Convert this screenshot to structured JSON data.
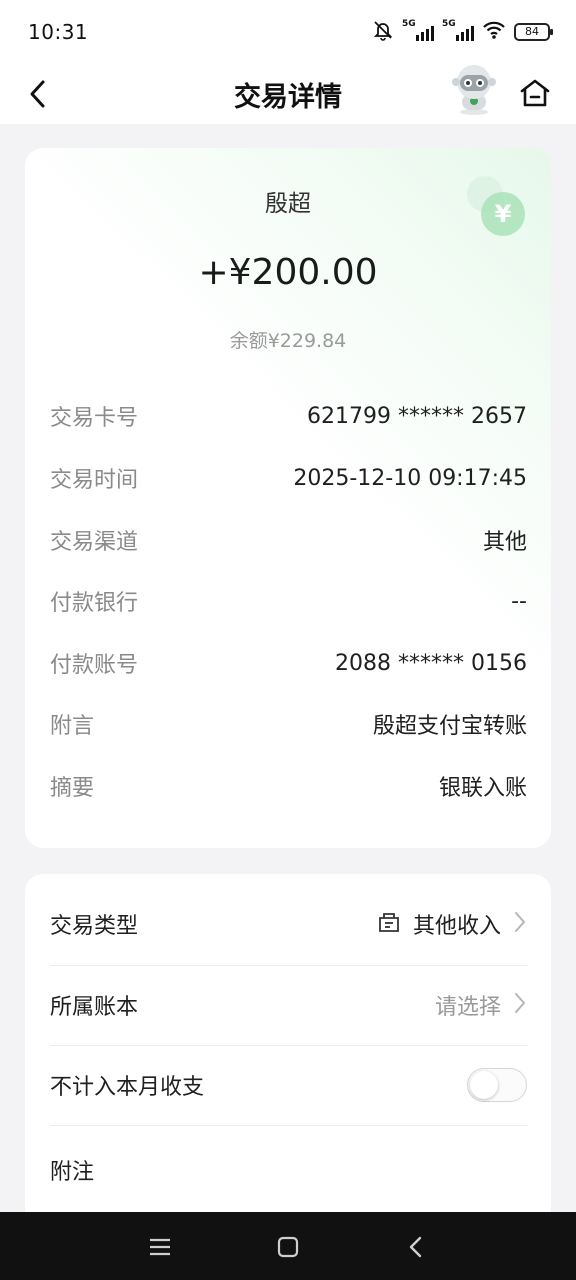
{
  "status_bar": {
    "time": "10:31",
    "signal1_label": "5G",
    "signal2_label": "5G",
    "battery": "84",
    "icons": [
      "bell-mute-icon",
      "signal-icon",
      "signal-icon",
      "wifi-icon",
      "battery-icon"
    ]
  },
  "nav": {
    "title": "交易详情",
    "icons": [
      "back-icon",
      "robot-mascot-icon",
      "home-icon"
    ]
  },
  "transaction": {
    "payer": "殷超",
    "amount": "+¥200.00",
    "balance": "余额¥229.84",
    "details": [
      {
        "label": "交易卡号",
        "value": "621799 ****** 2657"
      },
      {
        "label": "交易时间",
        "value": "2025-12-10 09:17:45"
      },
      {
        "label": "交易渠道",
        "value": "其他"
      },
      {
        "label": "付款银行",
        "value": "--"
      },
      {
        "label": "付款账号",
        "value": "2088 ****** 0156"
      },
      {
        "label": "附言",
        "value": "殷超支付宝转账"
      },
      {
        "label": "摘要",
        "value": "银联入账"
      }
    ]
  },
  "settings": {
    "type_label": "交易类型",
    "type_value": "其他收入",
    "ledger_label": "所属账本",
    "ledger_value": "请选择",
    "exclude_label": "不计入本月收支",
    "exclude_enabled": false,
    "note_label": "附注"
  },
  "colors": {
    "accent_green": "#7ed89b",
    "muted_text": "#8a8a8a",
    "background": "#f3f3f5"
  }
}
